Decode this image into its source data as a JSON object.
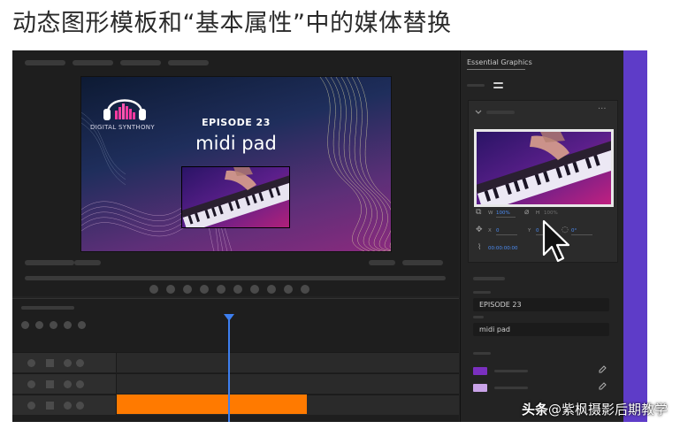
{
  "heading": "动态图形模板和“基本属性”中的媒体替换",
  "canvas": {
    "brand": "DIGITAL SYNTHONY",
    "episode": "EPISODE 23",
    "title": "midi pad"
  },
  "panel": {
    "title": "Essential Graphics",
    "properties": {
      "width_label": "W",
      "width_value": "100%",
      "height_label": "H",
      "height_value": "100%",
      "x_label": "X",
      "x_value": "0",
      "y_label": "Y",
      "y_value": "0",
      "rotation_value": "0°",
      "time_value": "00:00:00:00"
    },
    "text_fields": [
      {
        "value": "EPISODE 23"
      },
      {
        "value": "midi pad"
      }
    ],
    "colors": {
      "swatch_1": "#7a2fbf",
      "swatch_2": "#c9a3e8",
      "accent_strip": "#5e3cc8",
      "timeline_clip": "#ff7a00",
      "playhead": "#3d7ff0"
    }
  },
  "icons": [
    "headphones-logo-icon",
    "link-icon",
    "move-icon",
    "anchor-icon",
    "eyedropper-icon",
    "rotation-icon",
    "more-icon",
    "chevron-down-icon",
    "cursor-icon"
  ],
  "watermark": {
    "prefix": "头条",
    "text": "@紫枫摄影后期教学"
  }
}
